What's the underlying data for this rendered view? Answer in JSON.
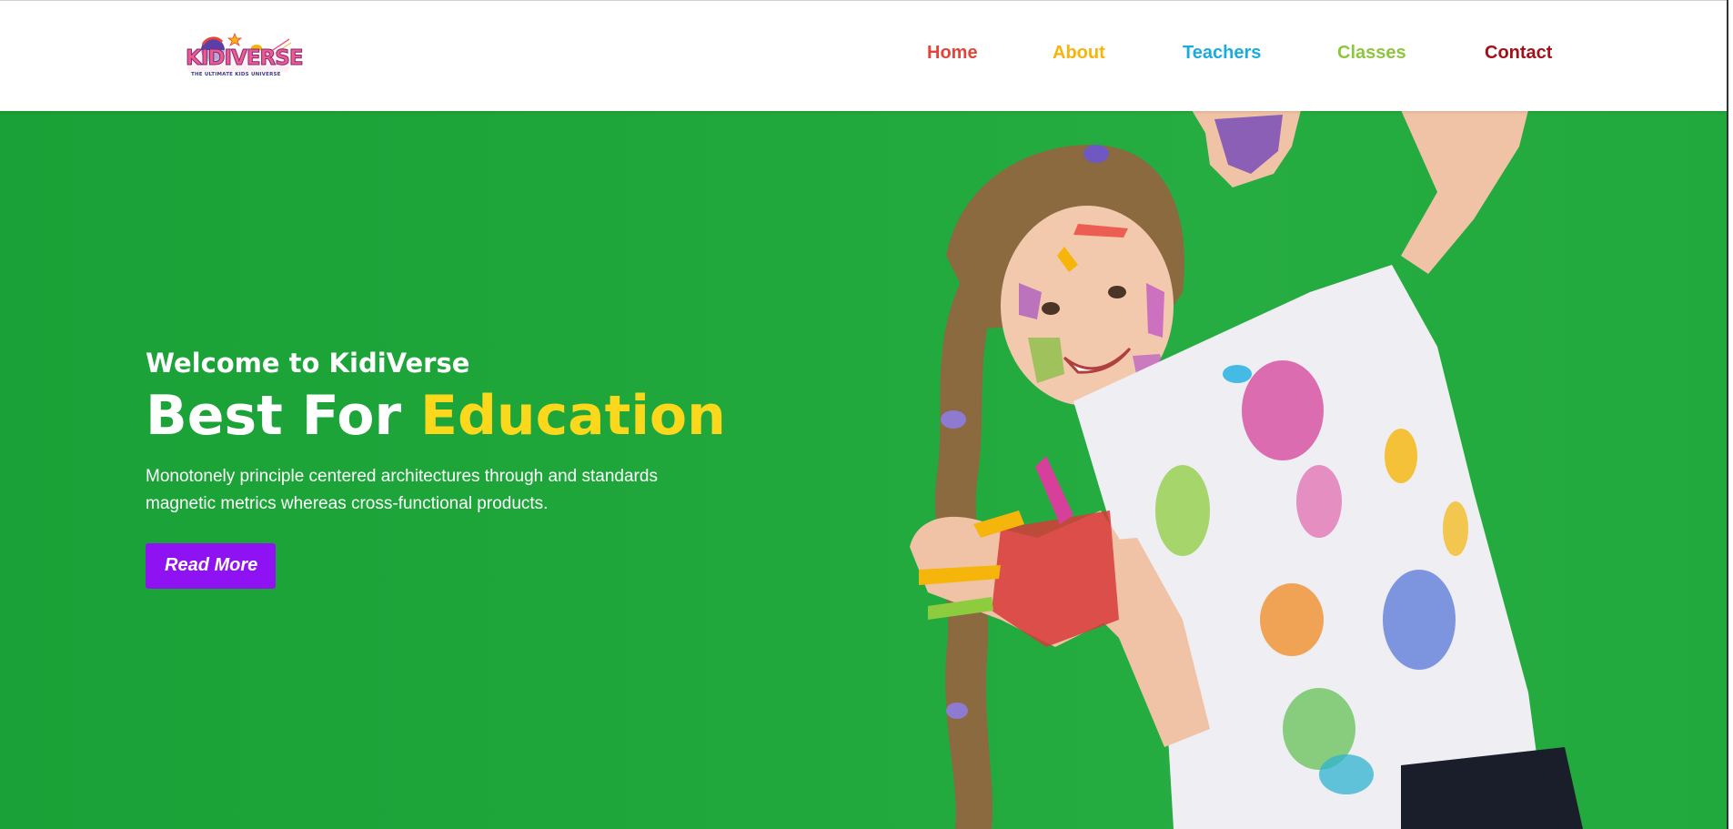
{
  "brand": {
    "logo_text": "KIDIVERSE",
    "logo_tagline": "THE ULTIMATE KIDS UNIVERSE"
  },
  "nav": {
    "home": "Home",
    "about": "About",
    "teachers": "Teachers",
    "classes": "Classes",
    "contact": "Contact"
  },
  "hero": {
    "welcome": "Welcome to KidiVerse",
    "headline_main": "Best For ",
    "headline_accent": "Education",
    "description": "Monotonely principle centered architectures through and standards magnetic metrics whereas cross-functional products.",
    "button_label": "Read More"
  },
  "colors": {
    "hero_background": "#1ea63a",
    "accent_yellow": "#fcd81c",
    "button_purple": "#8f13f2",
    "nav_home": "#e8433a",
    "nav_about": "#f5b50a",
    "nav_teachers": "#1aace0",
    "nav_classes": "#8dc63f",
    "nav_contact": "#a3101a"
  }
}
